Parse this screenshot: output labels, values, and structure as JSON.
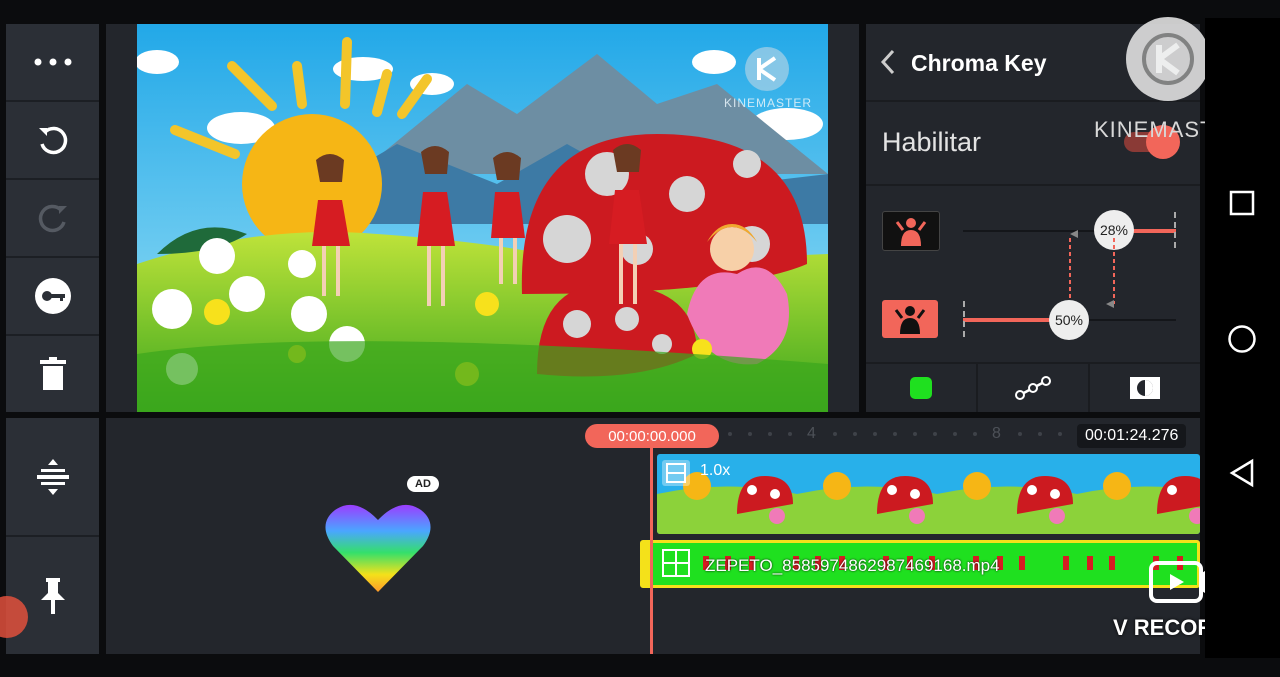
{
  "panel": {
    "title": "Chroma Key",
    "enable_label": "Habilitar",
    "slider_top_value": "28%",
    "slider_top_level": 0.28,
    "slider_bottom_value": "50%",
    "slider_bottom_level": 0.5
  },
  "preview": {
    "watermark": "KINEMASTER"
  },
  "branding": {
    "kinemaster": "KINEMASTER",
    "recorder": "V RECORDER"
  },
  "timeline": {
    "current_time": "00:00:00.000",
    "total_time": "00:01:24.276",
    "ruler_marks": [
      "4",
      "8"
    ],
    "clip1_speed": "1.0x",
    "clip2_name": "ZEPETO_8585974862987469168.mp4"
  },
  "ad_badge": "AD",
  "colors": {
    "accent": "#f2665a",
    "clip_green": "#1fe01f",
    "clip_border": "#f4e11a",
    "panel_bg": "#23262c"
  },
  "icons": {
    "more": "more-dots-icon",
    "undo": "undo-icon",
    "redo": "redo-icon",
    "key": "key-icon",
    "delete": "trash-icon",
    "split": "split-icon",
    "pin": "pin-icon"
  }
}
